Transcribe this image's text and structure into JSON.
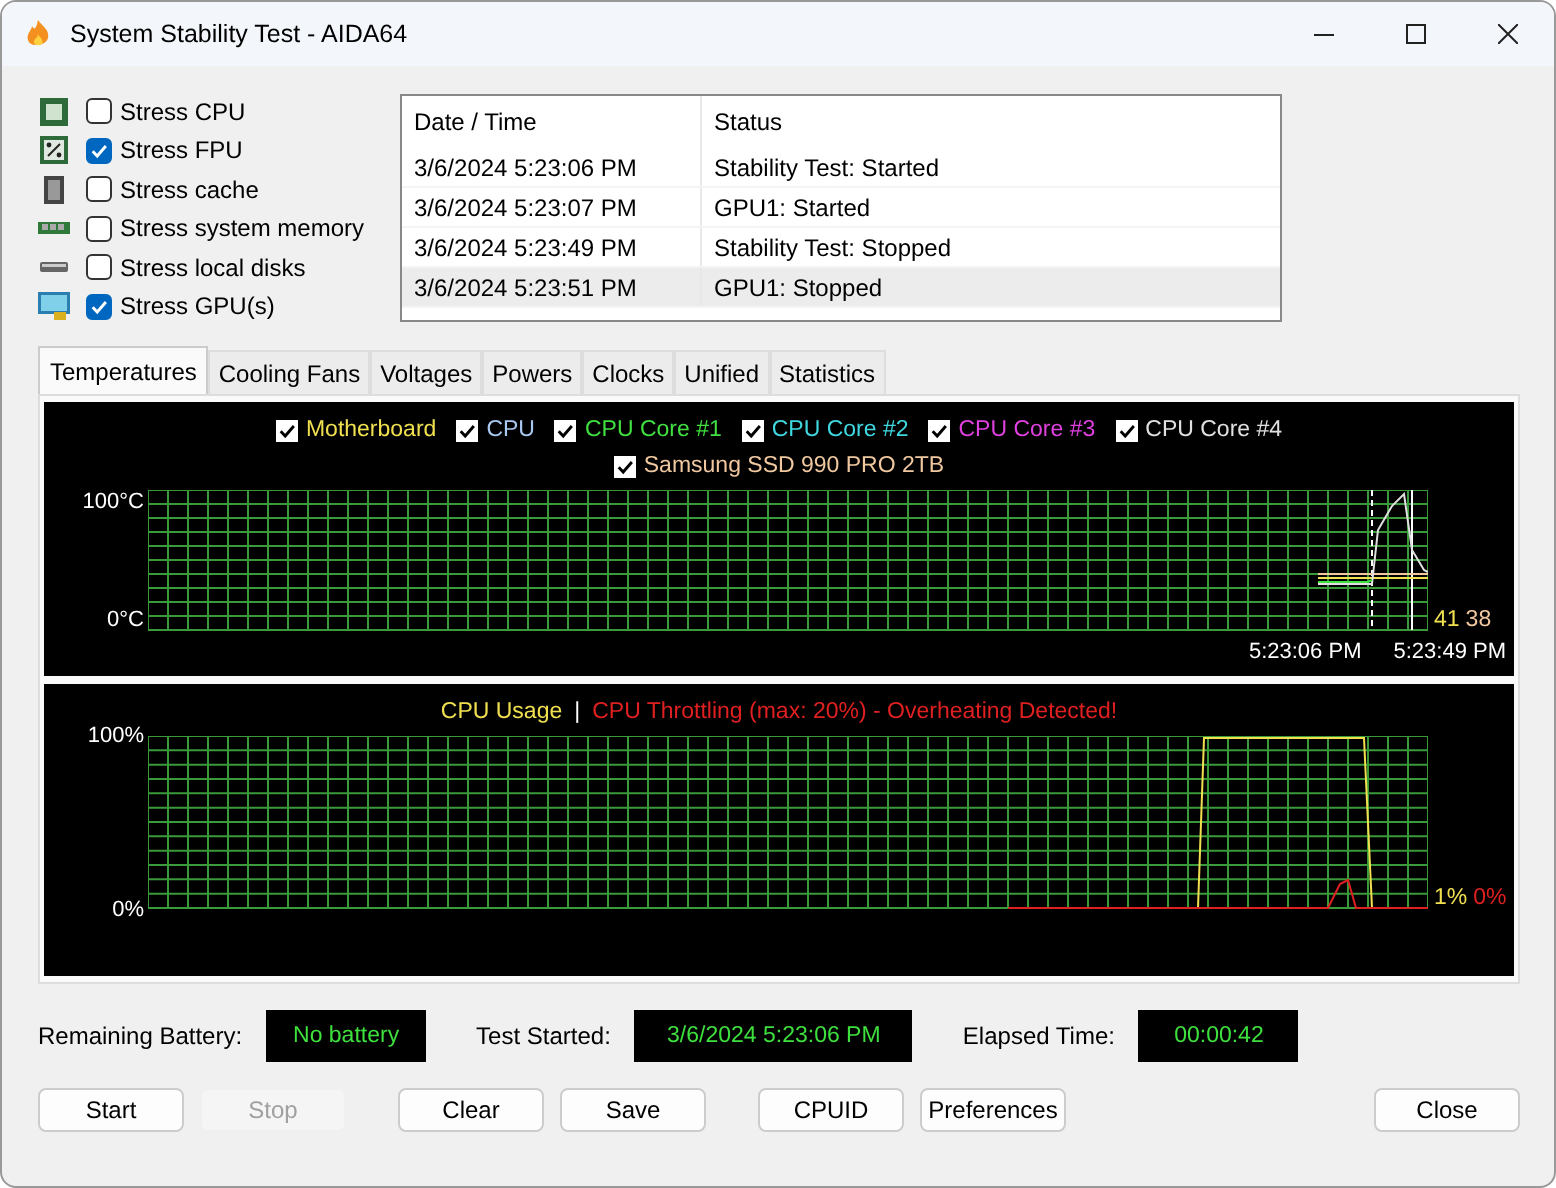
{
  "window": {
    "title": "System Stability Test - AIDA64"
  },
  "stress_options": [
    {
      "kind": "cpu",
      "label": "Stress CPU",
      "checked": false
    },
    {
      "kind": "fpu",
      "label": "Stress FPU",
      "checked": true
    },
    {
      "kind": "cache",
      "label": "Stress cache",
      "checked": false
    },
    {
      "kind": "memory",
      "label": "Stress system memory",
      "checked": false
    },
    {
      "kind": "disk",
      "label": "Stress local disks",
      "checked": false
    },
    {
      "kind": "gpu",
      "label": "Stress GPU(s)",
      "checked": true
    }
  ],
  "log": {
    "columns": [
      "Date / Time",
      "Status"
    ],
    "rows": [
      {
        "date": "3/6/2024 5:23:06 PM",
        "status": "Stability Test: Started",
        "selected": false
      },
      {
        "date": "3/6/2024 5:23:07 PM",
        "status": "GPU1: Started",
        "selected": false
      },
      {
        "date": "3/6/2024 5:23:49 PM",
        "status": "Stability Test: Stopped",
        "selected": false
      },
      {
        "date": "3/6/2024 5:23:51 PM",
        "status": "GPU1: Stopped",
        "selected": true
      }
    ]
  },
  "tabs": [
    {
      "label": "Temperatures",
      "selected": true
    },
    {
      "label": "Cooling Fans",
      "selected": false
    },
    {
      "label": "Voltages",
      "selected": false
    },
    {
      "label": "Powers",
      "selected": false
    },
    {
      "label": "Clocks",
      "selected": false
    },
    {
      "label": "Unified",
      "selected": false
    },
    {
      "label": "Statistics",
      "selected": false
    }
  ],
  "temperature_chart": {
    "legend": [
      {
        "label": "Motherboard",
        "checked": true,
        "color": "#f0e050"
      },
      {
        "label": "CPU",
        "checked": true,
        "color": "#a8c8f0"
      },
      {
        "label": "CPU Core #1",
        "checked": true,
        "color": "#40e040"
      },
      {
        "label": "CPU Core #2",
        "checked": true,
        "color": "#40d8e0"
      },
      {
        "label": "CPU Core #3",
        "checked": true,
        "color": "#e040e0"
      },
      {
        "label": "CPU Core #4",
        "checked": true,
        "color": "#e0e0e0"
      },
      {
        "label": "Samsung SSD 990 PRO 2TB",
        "checked": true,
        "color": "#f0c8a0"
      }
    ],
    "y_labels": [
      "100°C",
      "0°C"
    ],
    "x_labels": [
      "5:23:06 PM",
      "5:23:49 PM"
    ],
    "readings": [
      {
        "text": "41",
        "color": "#f0e050"
      },
      {
        "text": "38",
        "color": "#f0c8a0"
      }
    ]
  },
  "usage_chart": {
    "legend": [
      {
        "label": "CPU Usage",
        "color": "#f0e050"
      },
      {
        "label": "|",
        "color": "#ffffff"
      },
      {
        "label": "CPU Throttling (max: 20%) - Overheating Detected!",
        "color": "#e02020"
      }
    ],
    "y_labels": [
      "100%",
      "0%"
    ],
    "readings": [
      {
        "text": "1%",
        "color": "#f0e050"
      },
      {
        "text": "0%",
        "color": "#e02020"
      }
    ]
  },
  "status": [
    {
      "label": "Remaining Battery:",
      "value": "No battery"
    },
    {
      "label": "Test Started:",
      "value": "3/6/2024 5:23:06 PM"
    },
    {
      "label": "Elapsed Time:",
      "value": "00:00:42"
    }
  ],
  "buttons": [
    {
      "label": "Start",
      "disabled": false
    },
    {
      "label": "Stop",
      "disabled": true
    },
    {
      "label": "Clear",
      "disabled": false
    },
    {
      "label": "Save",
      "disabled": false
    },
    {
      "label": "CPUID",
      "disabled": false
    },
    {
      "label": "Preferences",
      "disabled": false
    },
    {
      "label": "Close",
      "disabled": false
    }
  ]
}
